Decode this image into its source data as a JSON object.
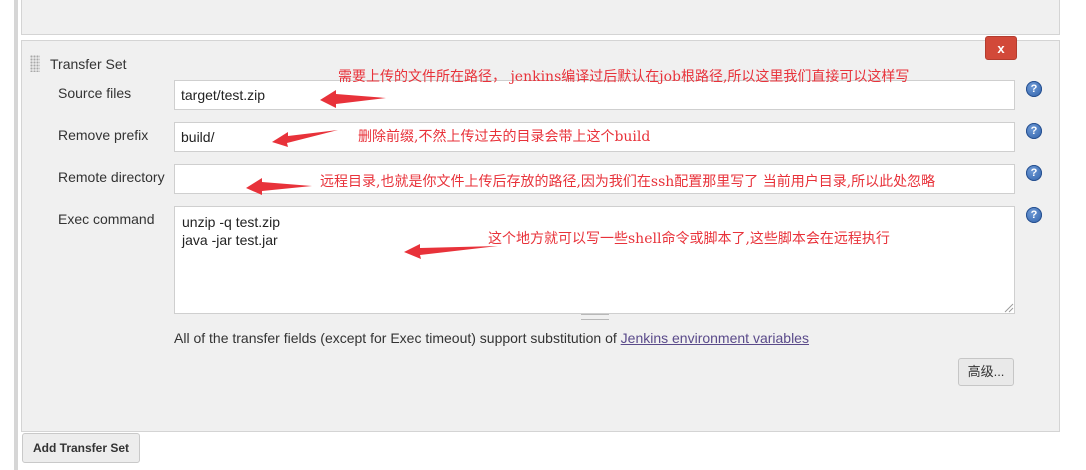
{
  "transfer_set": {
    "title": "Transfer Set",
    "delete_label": "x",
    "fields": {
      "source_files": {
        "label": "Source files",
        "value": "target/test.zip"
      },
      "remove_prefix": {
        "label": "Remove prefix",
        "value": "build/"
      },
      "remote_directory": {
        "label": "Remote directory",
        "value": ""
      },
      "exec_command": {
        "label": "Exec command",
        "value": "unzip -q test.zip\njava -jar test.jar"
      }
    },
    "help_icon_glyph": "?",
    "hint": {
      "text": "All of the transfer fields (except for Exec timeout) support substitution of ",
      "link": "Jenkins environment variables"
    },
    "advanced_label": "高级..."
  },
  "add_transfer_set_label": "Add Transfer Set",
  "annotations": {
    "source_files": "需要上传的文件所在路径， jenkins编译过后默认在job根路径,所以这里我们直接可以这样写",
    "remove_prefix": "删除前缀,不然上传过去的目录会带上这个build",
    "remote_directory": "远程目录,也就是你文件上传后存放的路径,因为我们在ssh配置那里写了 当前用户目录,所以此处忽略",
    "exec_command": "这个地方就可以写一些shell命令或脚本了,这些脚本会在远程执行"
  },
  "colors": {
    "panel_bg": "#f0f0f0",
    "delete_button": "#d24939",
    "annotation": "#e8323a",
    "help_icon": "#2d5fa8",
    "link": "#5a4a8a"
  },
  "icons": {
    "help": "help-icon",
    "delete": "close-icon",
    "drag": "drag-handle-icon",
    "annotation_arrow": "arrow-left-icon"
  }
}
